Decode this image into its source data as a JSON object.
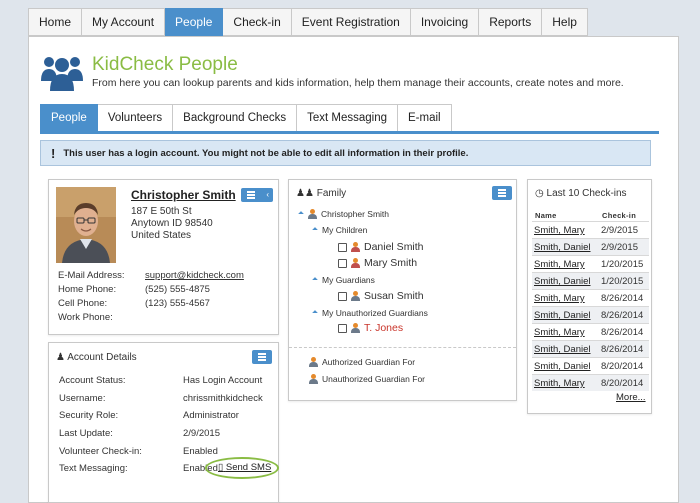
{
  "top_nav": {
    "tabs": [
      "Home",
      "My Account",
      "People",
      "Check-in",
      "Event Registration",
      "Invoicing",
      "Reports",
      "Help"
    ],
    "active": "People"
  },
  "header": {
    "icon": "people-group-icon",
    "title": "KidCheck People",
    "description": "From here you can lookup parents and kids information, help them manage their accounts, create notes and more."
  },
  "sub_tabs": {
    "tabs": [
      "People",
      "Volunteers",
      "Background Checks",
      "Text Messaging",
      "E-mail"
    ],
    "active": "People"
  },
  "alert": {
    "icon": "!",
    "text": "This user has a login account. You might not be able to edit all information in their profile."
  },
  "profile": {
    "name": "Christopher Smith",
    "address_line1": "187 E 50th St",
    "address_line2": "Anytown ID 98540",
    "address_line3": "United States",
    "fields": [
      {
        "label": "E-Mail Address:",
        "value": "support@kidcheck.com"
      },
      {
        "label": "Home Phone:",
        "value": "(525) 555-4875"
      },
      {
        "label": "Cell Phone:",
        "value": "(123) 555-4567"
      },
      {
        "label": "Work Phone:",
        "value": ""
      }
    ]
  },
  "account_details": {
    "title": "Account Details",
    "rows": [
      {
        "label": "Account Status:",
        "value": "Has Login Account"
      },
      {
        "label": "Username:",
        "value": "chrissmithkidcheck"
      },
      {
        "label": "Security Role:",
        "value": "Administrator"
      },
      {
        "label": "Last Update:",
        "value": "2/9/2015"
      },
      {
        "label": "Volunteer Check-in:",
        "value": "Enabled"
      },
      {
        "label": "Text Messaging:",
        "value": "Enabled"
      }
    ],
    "send_sms_label": "Send SMS"
  },
  "family": {
    "title": "Family",
    "root": "Christopher Smith",
    "children_label": "My Children",
    "children": [
      "Daniel Smith",
      "Mary Smith"
    ],
    "guardians_label": "My Guardians",
    "guardians": [
      "Susan Smith"
    ],
    "unauthorized_label": "My Unauthorized Guardians",
    "unauthorized": [
      "T. Jones"
    ],
    "authorized_for_label": "Authorized Guardian For",
    "unauthorized_for_label": "Unauthorized Guardian For"
  },
  "checkins": {
    "title": "Last 10 Check-ins",
    "col_name": "Name",
    "col_checkin": "Check-in",
    "rows": [
      {
        "name": "Smith, Mary",
        "date": "2/9/2015"
      },
      {
        "name": "Smith, Daniel",
        "date": "2/9/2015"
      },
      {
        "name": "Smith, Mary",
        "date": "1/20/2015"
      },
      {
        "name": "Smith, Daniel",
        "date": "1/20/2015"
      },
      {
        "name": "Smith, Mary",
        "date": "8/26/2014"
      },
      {
        "name": "Smith, Daniel",
        "date": "8/26/2014"
      },
      {
        "name": "Smith, Mary",
        "date": "8/26/2014"
      },
      {
        "name": "Smith, Daniel",
        "date": "8/26/2014"
      },
      {
        "name": "Smith, Daniel",
        "date": "8/20/2014"
      },
      {
        "name": "Smith, Mary",
        "date": "8/20/2014"
      }
    ],
    "more_label": "More..."
  },
  "colors": {
    "accent_blue": "#4a8fcb",
    "brand_green": "#8abc44",
    "alert_bg": "#d9e7f4",
    "unauthorized_red": "#c9342a"
  }
}
